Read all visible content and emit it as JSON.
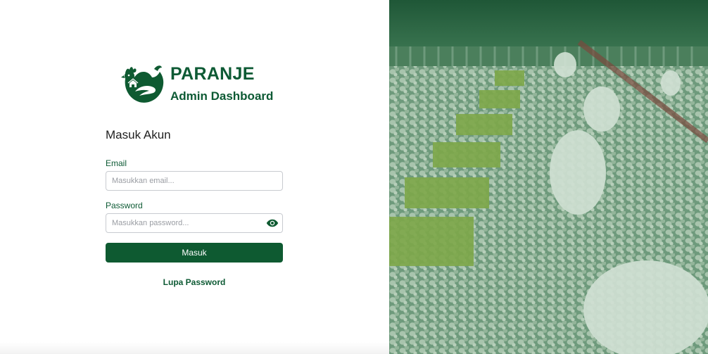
{
  "brand": {
    "name": "PARANJE",
    "subtitle": "Admin Dashboard",
    "color": "#0d5a34",
    "logo_icon": "hen-icon"
  },
  "form": {
    "title": "Masuk Akun",
    "email_label": "Email",
    "email_placeholder": "Masukkan email...",
    "email_value": "",
    "password_label": "Password",
    "password_placeholder": "Masukkan password...",
    "password_value": "",
    "password_toggle_icon": "eye-icon",
    "submit_label": "Masuk",
    "forgot_label": "Lupa Password"
  },
  "hero": {
    "description_icon": "poultry-farm-photo",
    "overlay_color": "#2f6a47"
  }
}
